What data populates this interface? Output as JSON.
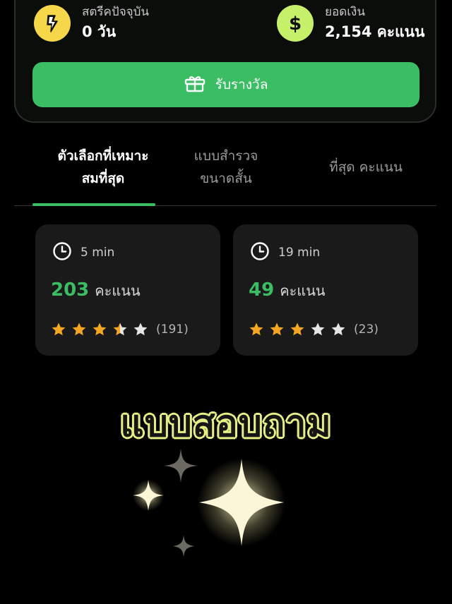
{
  "stats": {
    "streak": {
      "label": "สตรีคปัจจุบัน",
      "value": "0 วัน",
      "icon": "lightning-icon",
      "color": "#f7d74a"
    },
    "balance": {
      "label": "ยอดเงิน",
      "value": "2,154 คะแนน",
      "icon": "dollar-icon",
      "color": "#c7f06a"
    }
  },
  "reward_button": {
    "label": "รับรางวัล",
    "icon": "gift-icon"
  },
  "tabs": [
    {
      "label": "ตัวเลือกที่เหมาะสมที่สุด",
      "line1": "ตัวเลือกที่เหมาะ",
      "line2": "สมที่สุด",
      "active": true
    },
    {
      "label": "แบบสำรวจขนาดสั้น",
      "line1": "แบบสำรวจ",
      "line2": "ขนาดสั้น",
      "active": false
    },
    {
      "label": "ที่สุด คะแนน",
      "line1": "ที่สุด คะแนน",
      "active": false
    }
  ],
  "surveys": [
    {
      "duration": "5 min",
      "points": "203",
      "points_unit": "คะแนน",
      "rating": 3.5,
      "rating_count": "(191)"
    },
    {
      "duration": "19 min",
      "points": "49",
      "points_unit": "คะแนน",
      "rating": 3,
      "rating_count": "(23)"
    }
  ],
  "hero_title": "แบบสอบถาม",
  "colors": {
    "accent": "#3bbd63",
    "star": "#f5a623",
    "star_empty": "#e6e6e6",
    "title_outline": "#e6ee86"
  }
}
